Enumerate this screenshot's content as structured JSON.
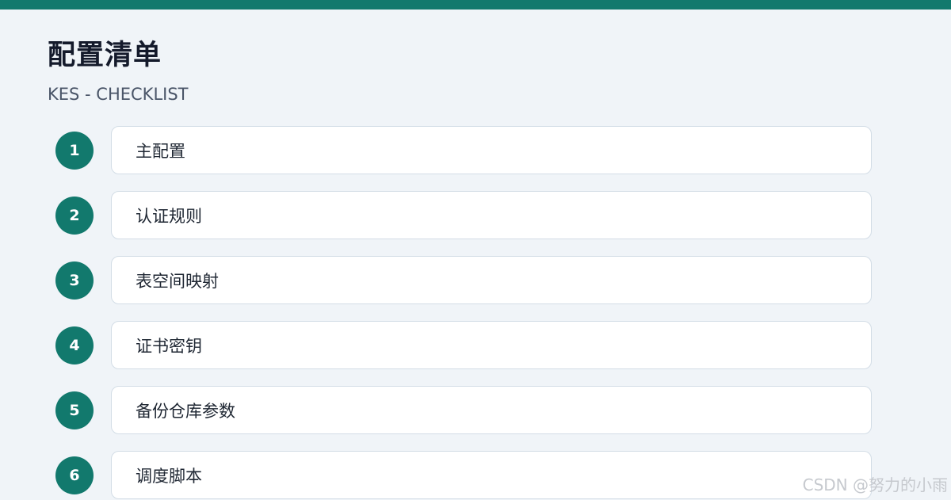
{
  "header": {
    "title": "配置清单",
    "subtitle": "KES - CHECKLIST"
  },
  "accent_color": "#12796d",
  "items": [
    {
      "number": "1",
      "label": "主配置"
    },
    {
      "number": "2",
      "label": "认证规则"
    },
    {
      "number": "3",
      "label": "表空间映射"
    },
    {
      "number": "4",
      "label": "证书密钥"
    },
    {
      "number": "5",
      "label": "备份仓库参数"
    },
    {
      "number": "6",
      "label": "调度脚本"
    }
  ],
  "watermark": "CSDN @努力的小雨"
}
